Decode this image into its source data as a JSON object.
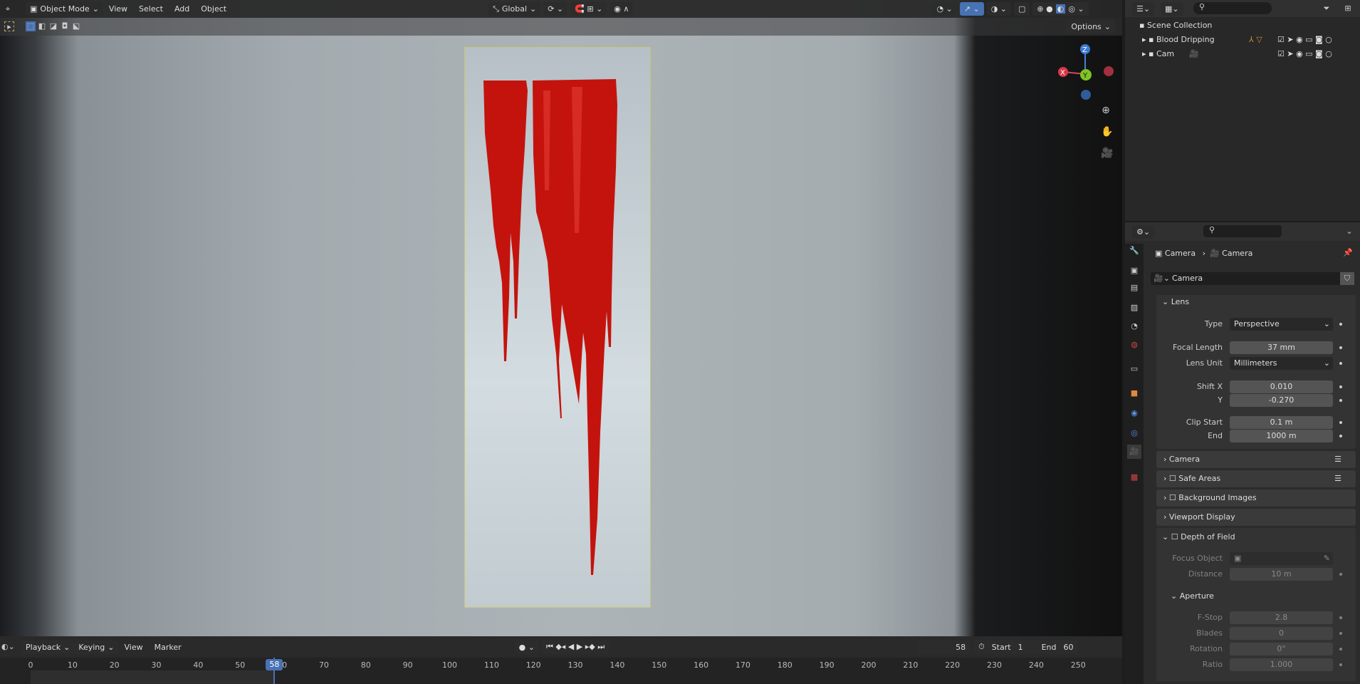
{
  "header": {
    "mode": "Object Mode",
    "menus": [
      "View",
      "Select",
      "Add",
      "Object"
    ],
    "orientation": "Global",
    "options": "Options"
  },
  "gizmo": {
    "z": "Z",
    "y": "Y",
    "x": "X"
  },
  "outliner": {
    "root": "Scene Collection",
    "items": [
      {
        "label": "Blood Dripping"
      },
      {
        "label": "Cam"
      }
    ]
  },
  "properties": {
    "breadcrumb": [
      "Camera",
      "Camera"
    ],
    "datablock": "Camera",
    "lens": {
      "title": "Lens",
      "type_label": "Type",
      "type": "Perspective",
      "focal_label": "Focal Length",
      "focal": "37 mm",
      "unit_label": "Lens Unit",
      "unit": "Millimeters",
      "shiftx_label": "Shift X",
      "shiftx": "0.010",
      "shifty_label": "Y",
      "shifty": "-0.270",
      "clipstart_label": "Clip Start",
      "clipstart": "0.1 m",
      "clipend_label": "End",
      "clipend": "1000 m"
    },
    "panels": [
      "Camera",
      "Safe Areas",
      "Background Images",
      "Viewport Display"
    ],
    "dof": {
      "title": "Depth of Field",
      "focus_label": "Focus Object",
      "distance_label": "Distance",
      "distance": "10 m",
      "aperture": "Aperture",
      "fstop_label": "F-Stop",
      "fstop": "2.8",
      "blades_label": "Blades",
      "blades": "0",
      "rotation_label": "Rotation",
      "rotation": "0°",
      "ratio_label": "Ratio",
      "ratio": "1.000"
    }
  },
  "timeline": {
    "menus": [
      "Playback",
      "Keying",
      "View",
      "Marker"
    ],
    "current_frame": "58",
    "start_label": "Start",
    "start": "1",
    "end_label": "End",
    "end": "60",
    "ticks": [
      "0",
      "10",
      "20",
      "30",
      "40",
      "50",
      "60",
      "70",
      "80",
      "90",
      "100",
      "110",
      "120",
      "130",
      "140",
      "150",
      "160",
      "170",
      "180",
      "190",
      "200",
      "210",
      "220",
      "230",
      "240",
      "250"
    ],
    "playhead": 58
  }
}
